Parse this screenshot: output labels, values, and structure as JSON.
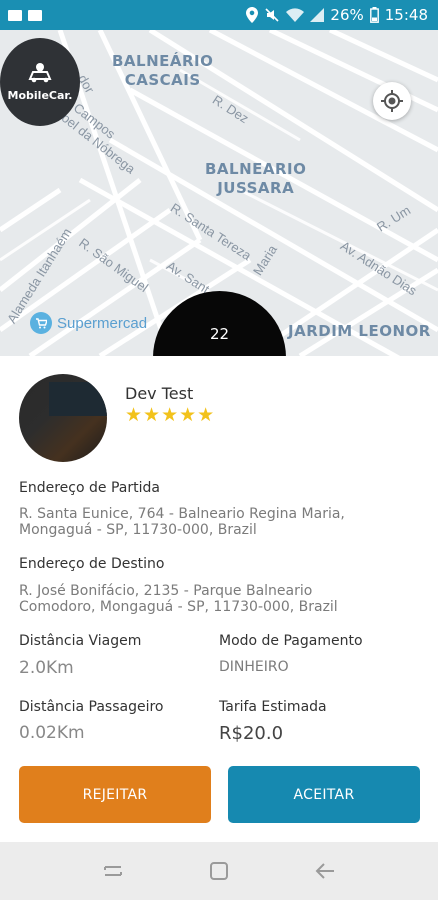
{
  "status_bar": {
    "battery": "26%",
    "time": "15:48"
  },
  "map": {
    "areas": [
      {
        "line1": "BALNEÁRIO",
        "line2": "CASCAIS"
      },
      {
        "line1": "BALNEARIO",
        "line2": "JUSSARA"
      },
      {
        "line1": "JARDIM LEONOR",
        "line2": ""
      }
    ],
    "streets": [
      "dor",
      "Campos",
      "oel da Nóbrega",
      "R. Dez",
      "R. Santa Tereza",
      "R. São Miguel",
      "Av. Sant",
      "Maria",
      "R. Um",
      "Av. Adnão Dias",
      "Alameda Itanhaém"
    ],
    "poi_label": "Supermercad",
    "logo_text": "MobileCar."
  },
  "timer": {
    "value": "22"
  },
  "driver": {
    "name": "Dev Test",
    "stars": "★★★★★"
  },
  "trip": {
    "pickup_label": "Endereço de Partida",
    "pickup_line1": "R. Santa Eunice, 764 - Balneario Regina Maria,",
    "pickup_line2": "Mongaguá - SP, 11730-000, Brazil",
    "destination_label": "Endereço de Destino",
    "destination_line1": "R. José Bonifácio, 2135 - Parque Balneario",
    "destination_line2": "Comodoro, Mongaguá - SP, 11730-000, Brazil",
    "trip_distance_label": "Distância Viagem",
    "trip_distance": "2.0Km",
    "payment_label": "Modo de Pagamento",
    "payment": "DINHEIRO",
    "passenger_distance_label": "Distância Passageiro",
    "passenger_distance": "0.02Km",
    "fare_label": "Tarifa Estimada",
    "fare": "R$20.0"
  },
  "actions": {
    "reject": "REJEITAR",
    "accept": "ACEITAR"
  },
  "colors": {
    "status_bar": "#1a8fb3",
    "reject": "#e07f1c",
    "accept": "#1689b0",
    "stars": "#f2c21b"
  }
}
